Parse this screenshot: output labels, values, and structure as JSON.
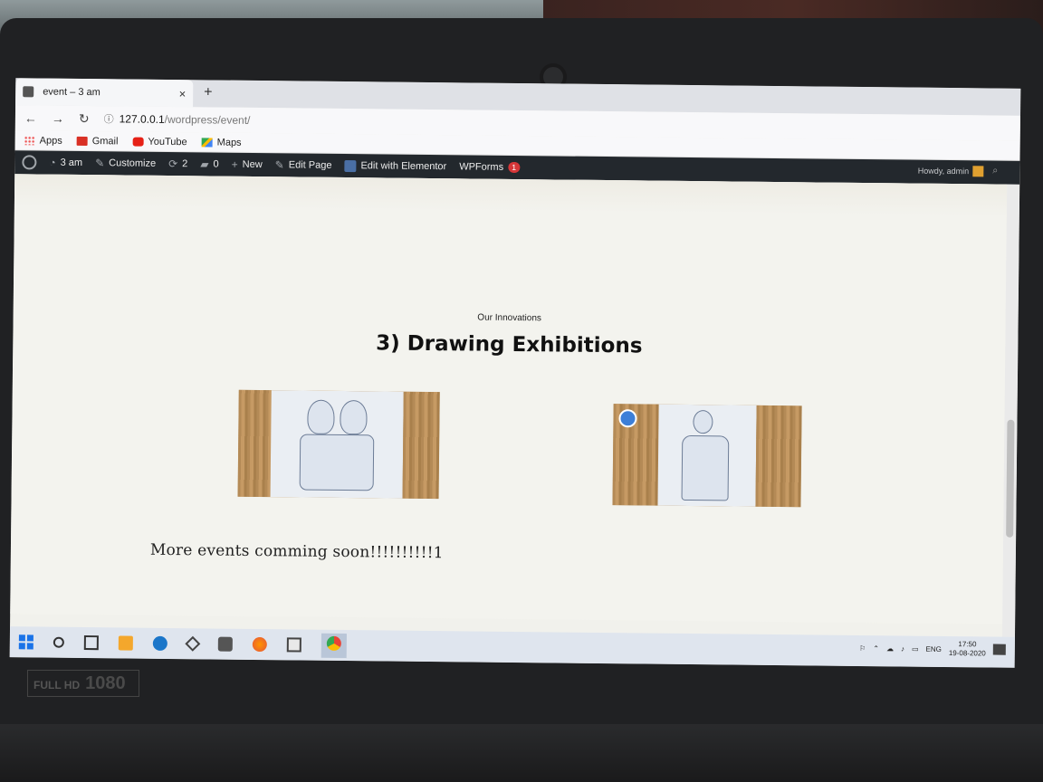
{
  "browser": {
    "tab_title": "event – 3 am",
    "tab_close": "×",
    "new_tab": "+",
    "nav": {
      "back": "←",
      "forward": "→",
      "reload": "↻"
    },
    "url_info": "ⓘ",
    "url_host": "127.0.0.1",
    "url_path": "/wordpress/event/",
    "bookmarks": [
      {
        "label": "Apps",
        "icon": "apps-icon"
      },
      {
        "label": "Gmail",
        "icon": "gmail-icon"
      },
      {
        "label": "YouTube",
        "icon": "youtube-icon"
      },
      {
        "label": "Maps",
        "icon": "maps-icon"
      }
    ],
    "window_controls": {
      "minimize": "–",
      "restore": "❐",
      "close": "✕"
    }
  },
  "admin_bar": {
    "site_name": "3 am",
    "customize": "Customize",
    "updates_count": "2",
    "comments_count": "0",
    "new_label": "New",
    "edit_page": "Edit Page",
    "edit_elementor": "Edit with Elementor",
    "wpforms": "WPForms",
    "wpforms_badge": "1",
    "howdy": "Howdy, admin"
  },
  "page": {
    "subtitle": "Our Innovations",
    "heading": "3) Drawing Exhibitions",
    "more_events": "More events comming soon!!!!!!!!!!1"
  },
  "taskbar": {
    "clock_time": "17:50",
    "clock_date": "19-08-2020",
    "language": "ENG"
  }
}
